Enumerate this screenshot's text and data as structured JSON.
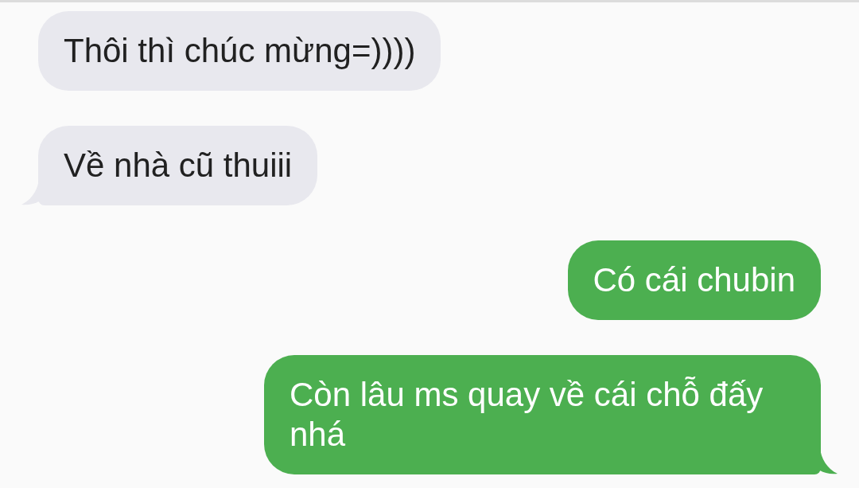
{
  "messages": [
    {
      "kind": "incoming",
      "text": "Thôi thì chúc mừng=))))",
      "tail": false
    },
    {
      "kind": "incoming",
      "text": "Về nhà cũ thuiii",
      "tail": true
    },
    {
      "kind": "outgoing",
      "text": "Có cái chubin",
      "tail": false
    },
    {
      "kind": "outgoing",
      "text": "Còn lâu ms quay về cái chỗ đấy nhá",
      "tail": true
    }
  ]
}
